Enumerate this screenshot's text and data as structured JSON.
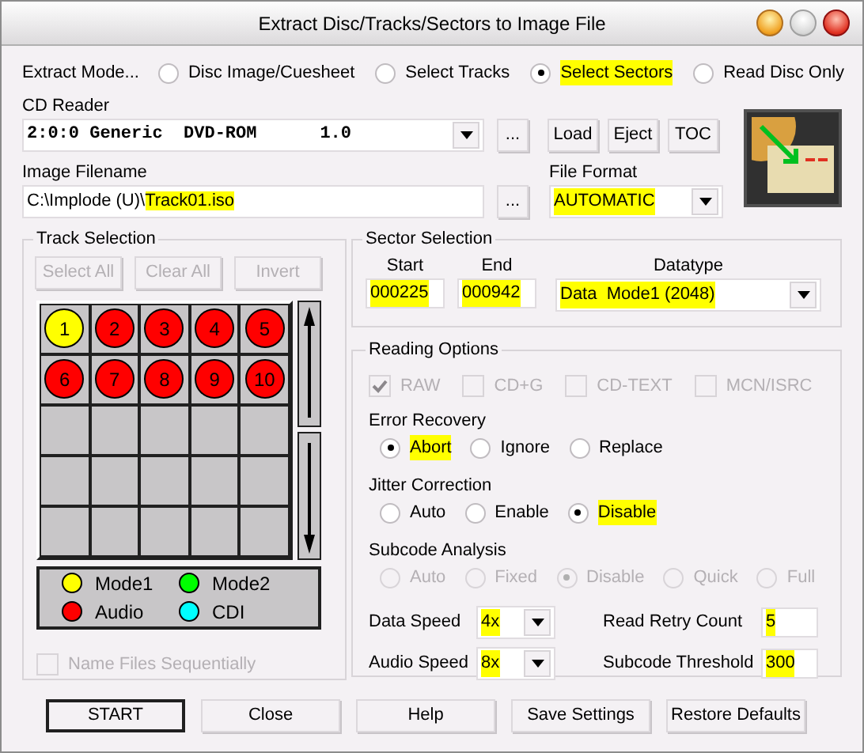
{
  "window": {
    "title": "Extract Disc/Tracks/Sectors to Image File"
  },
  "extract_mode": {
    "label": "Extract Mode...",
    "options": [
      {
        "label": "Disc Image/Cuesheet",
        "selected": false,
        "highlighted": false
      },
      {
        "label": "Select Tracks",
        "selected": false,
        "highlighted": false
      },
      {
        "label": "Select Sectors",
        "selected": true,
        "highlighted": true
      },
      {
        "label": "Read Disc Only",
        "selected": false,
        "highlighted": false
      }
    ]
  },
  "cd_reader": {
    "label": "CD Reader",
    "device": "2:0:0 Generic  DVD-ROM",
    "version": "1.0",
    "browse": "...",
    "buttons": [
      "Load",
      "Eject",
      "TOC"
    ]
  },
  "image_filename": {
    "label": "Image Filename",
    "directory": "C:\\Implode (U)\\",
    "file": "Track01.iso",
    "highlighted": true,
    "browse": "..."
  },
  "file_format": {
    "label": "File Format",
    "value": "AUTOMATIC",
    "highlighted": true
  },
  "track_selection": {
    "title": "Track Selection",
    "buttons": [
      {
        "label": "Select All",
        "disabled": true
      },
      {
        "label": "Clear All",
        "disabled": true
      },
      {
        "label": "Invert",
        "disabled": true
      }
    ],
    "tracks": [
      {
        "number": "1",
        "color": "#ffff00"
      },
      {
        "number": "2",
        "color": "#ff0000"
      },
      {
        "number": "3",
        "color": "#ff0000"
      },
      {
        "number": "4",
        "color": "#ff0000"
      },
      {
        "number": "5",
        "color": "#ff0000"
      },
      {
        "number": "6",
        "color": "#ff0000"
      },
      {
        "number": "7",
        "color": "#ff0000"
      },
      {
        "number": "8",
        "color": "#ff0000"
      },
      {
        "number": "9",
        "color": "#ff0000"
      },
      {
        "number": "10",
        "color": "#ff0000"
      }
    ],
    "legend": [
      {
        "label": "Mode1",
        "color": "#ffff00"
      },
      {
        "label": "Mode2",
        "color": "#00ff00"
      },
      {
        "label": "Audio",
        "color": "#ff0000"
      },
      {
        "label": "CDI",
        "color": "#00ffff"
      }
    ],
    "name_sequentially": {
      "label": "Name Files Sequentially",
      "checked": false,
      "disabled": true
    }
  },
  "sector_selection": {
    "title": "Sector Selection",
    "start": {
      "label": "Start",
      "value": "000225",
      "highlighted": true
    },
    "end": {
      "label": "End",
      "value": "000942",
      "highlighted": true
    },
    "datatype": {
      "label": "Datatype",
      "value": "Data  Mode1 (2048)",
      "highlighted": true
    }
  },
  "reading_options": {
    "title": "Reading Options",
    "checkboxes": [
      {
        "label": "RAW",
        "checked": true,
        "disabled": true
      },
      {
        "label": "CD+G",
        "checked": false,
        "disabled": true
      },
      {
        "label": "CD-TEXT",
        "checked": false,
        "disabled": true
      },
      {
        "label": "MCN/ISRC",
        "checked": false,
        "disabled": true
      }
    ],
    "groups": [
      {
        "title": "Error Recovery",
        "options": [
          {
            "label": "Abort",
            "selected": true,
            "highlighted": true,
            "disabled": false
          },
          {
            "label": "Ignore",
            "selected": false,
            "highlighted": false,
            "disabled": false
          },
          {
            "label": "Replace",
            "selected": false,
            "highlighted": false,
            "disabled": false
          }
        ]
      },
      {
        "title": "Jitter Correction",
        "options": [
          {
            "label": "Auto",
            "selected": false,
            "highlighted": false,
            "disabled": false
          },
          {
            "label": "Enable",
            "selected": false,
            "highlighted": false,
            "disabled": false
          },
          {
            "label": "Disable",
            "selected": true,
            "highlighted": true,
            "disabled": false
          }
        ]
      },
      {
        "title": "Subcode Analysis",
        "options": [
          {
            "label": "Auto",
            "selected": false,
            "highlighted": false,
            "disabled": true
          },
          {
            "label": "Fixed",
            "selected": false,
            "highlighted": false,
            "disabled": true
          },
          {
            "label": "Disable",
            "selected": true,
            "highlighted": false,
            "disabled": true
          },
          {
            "label": "Quick",
            "selected": false,
            "highlighted": false,
            "disabled": true
          },
          {
            "label": "Full",
            "selected": false,
            "highlighted": false,
            "disabled": true
          }
        ]
      }
    ],
    "data_speed": {
      "label": "Data Speed",
      "value": "4x",
      "highlighted": true
    },
    "audio_speed": {
      "label": "Audio Speed",
      "value": "8x",
      "highlighted": true
    },
    "read_retry_count": {
      "label": "Read Retry Count",
      "value": "5",
      "highlighted": true
    },
    "subcode_threshold": {
      "label": "Subcode Threshold",
      "value": "300",
      "highlighted": true
    }
  },
  "buttons": [
    {
      "label": "START",
      "default": true
    },
    {
      "label": "Close",
      "default": false
    },
    {
      "label": "Help",
      "default": false
    },
    {
      "label": "Save Settings",
      "default": false
    },
    {
      "label": "Restore Defaults",
      "default": false
    }
  ]
}
